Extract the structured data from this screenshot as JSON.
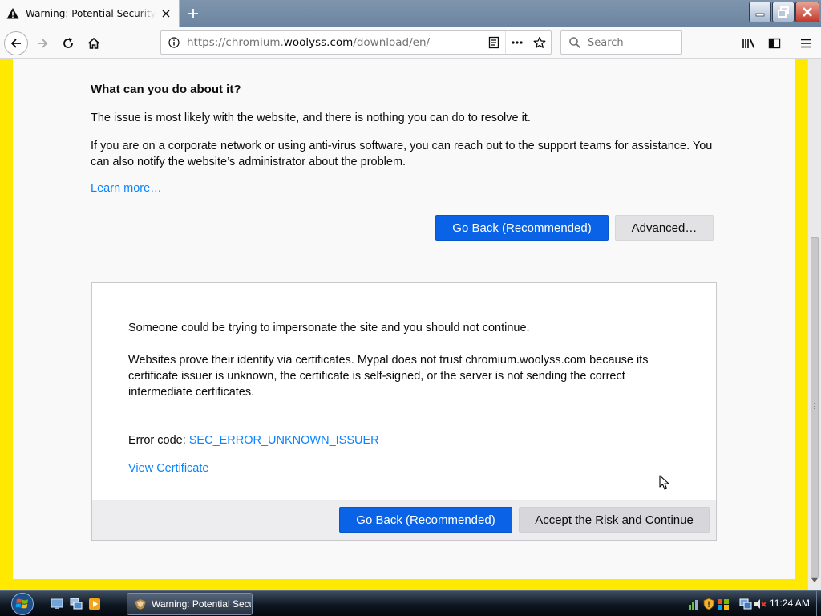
{
  "browser": {
    "tab": {
      "title": "Warning: Potential Security Risk Ahead"
    },
    "url": {
      "prefix": "https://chromium.",
      "host": "woolyss.com",
      "path": "/download/en/"
    },
    "search": {
      "placeholder": "Search"
    }
  },
  "page": {
    "heading": "What can you do about it?",
    "paragraph1": "The issue is most likely with the website, and there is nothing you can do to resolve it.",
    "paragraph2": "If you are on a corporate network or using anti-virus software, you can reach out to the support teams for assistance. You can also notify the website’s administrator about the problem.",
    "learn_more": "Learn more…",
    "go_back_label": "Go Back (Recommended)",
    "advanced_label": "Advanced…",
    "advanced_panel": {
      "p1": "Someone could be trying to impersonate the site and you should not continue.",
      "p2": "Websites prove their identity via certificates. Mypal does not trust chromium.woolyss.com because its certificate issuer is unknown, the certificate is self-signed, or the server is not sending the correct intermediate certificates.",
      "error_label": "Error code: ",
      "error_code": "SEC_ERROR_UNKNOWN_ISSUER",
      "view_certificate": "View Certificate",
      "go_back_label": "Go Back (Recommended)",
      "accept_label": "Accept the Risk and Continue"
    }
  },
  "taskbar": {
    "window_label": "Warning: Potential Security Risk Ahead",
    "clock": "11:24 AM"
  },
  "colors": {
    "page_frame": "#ffe900",
    "primary_button": "#0a63e6",
    "link": "#0a84ff"
  }
}
